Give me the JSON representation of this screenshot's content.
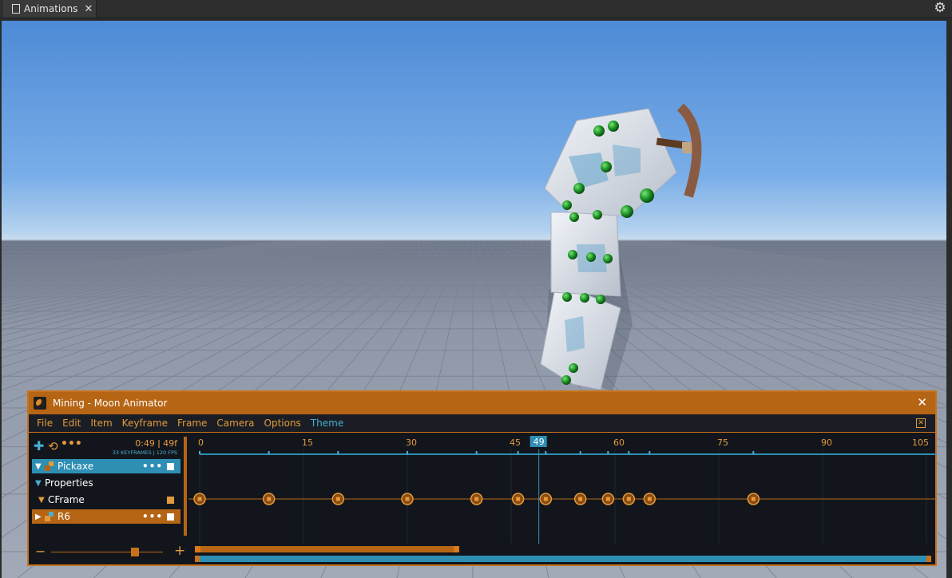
{
  "topbar": {
    "tab_label": "Animations",
    "tab_close": "✕",
    "settings_icon": "gear-icon"
  },
  "viewport": {
    "scene": "3D viewport"
  },
  "animator": {
    "title": "Mining - Moon Animator",
    "close": "✕",
    "menu": [
      "File",
      "Edit",
      "Item",
      "Keyframe",
      "Frame",
      "Camera",
      "Options",
      "Theme"
    ],
    "active_menu": "Theme",
    "time_display": "0:49  ǀ  49f",
    "keyframe_info": "33 KEYFRAMES ǀ 120 FPS",
    "tree": [
      {
        "label": "Pickaxe",
        "expanded": true,
        "selected": true,
        "kind": "item"
      },
      {
        "label": "Properties",
        "expanded": true,
        "kind": "group"
      },
      {
        "label": "CFrame",
        "expanded": true,
        "kind": "property"
      },
      {
        "label": "R6",
        "expanded": false,
        "kind": "item"
      }
    ],
    "timeline": {
      "frame_min": 0,
      "frame_max": 105,
      "ruler_labels": [
        "0",
        "15",
        "30",
        "45",
        "60",
        "75",
        "90",
        "105"
      ],
      "current_frame": 49,
      "current_frame_label": "49",
      "keyframes": [
        0,
        10,
        20,
        30,
        40,
        46,
        50,
        55,
        59,
        62,
        65,
        80
      ]
    },
    "colors": {
      "accent_orange": "#c8731a",
      "accent_blue": "#2f8eb4",
      "panel_bg": "#12161c"
    }
  }
}
